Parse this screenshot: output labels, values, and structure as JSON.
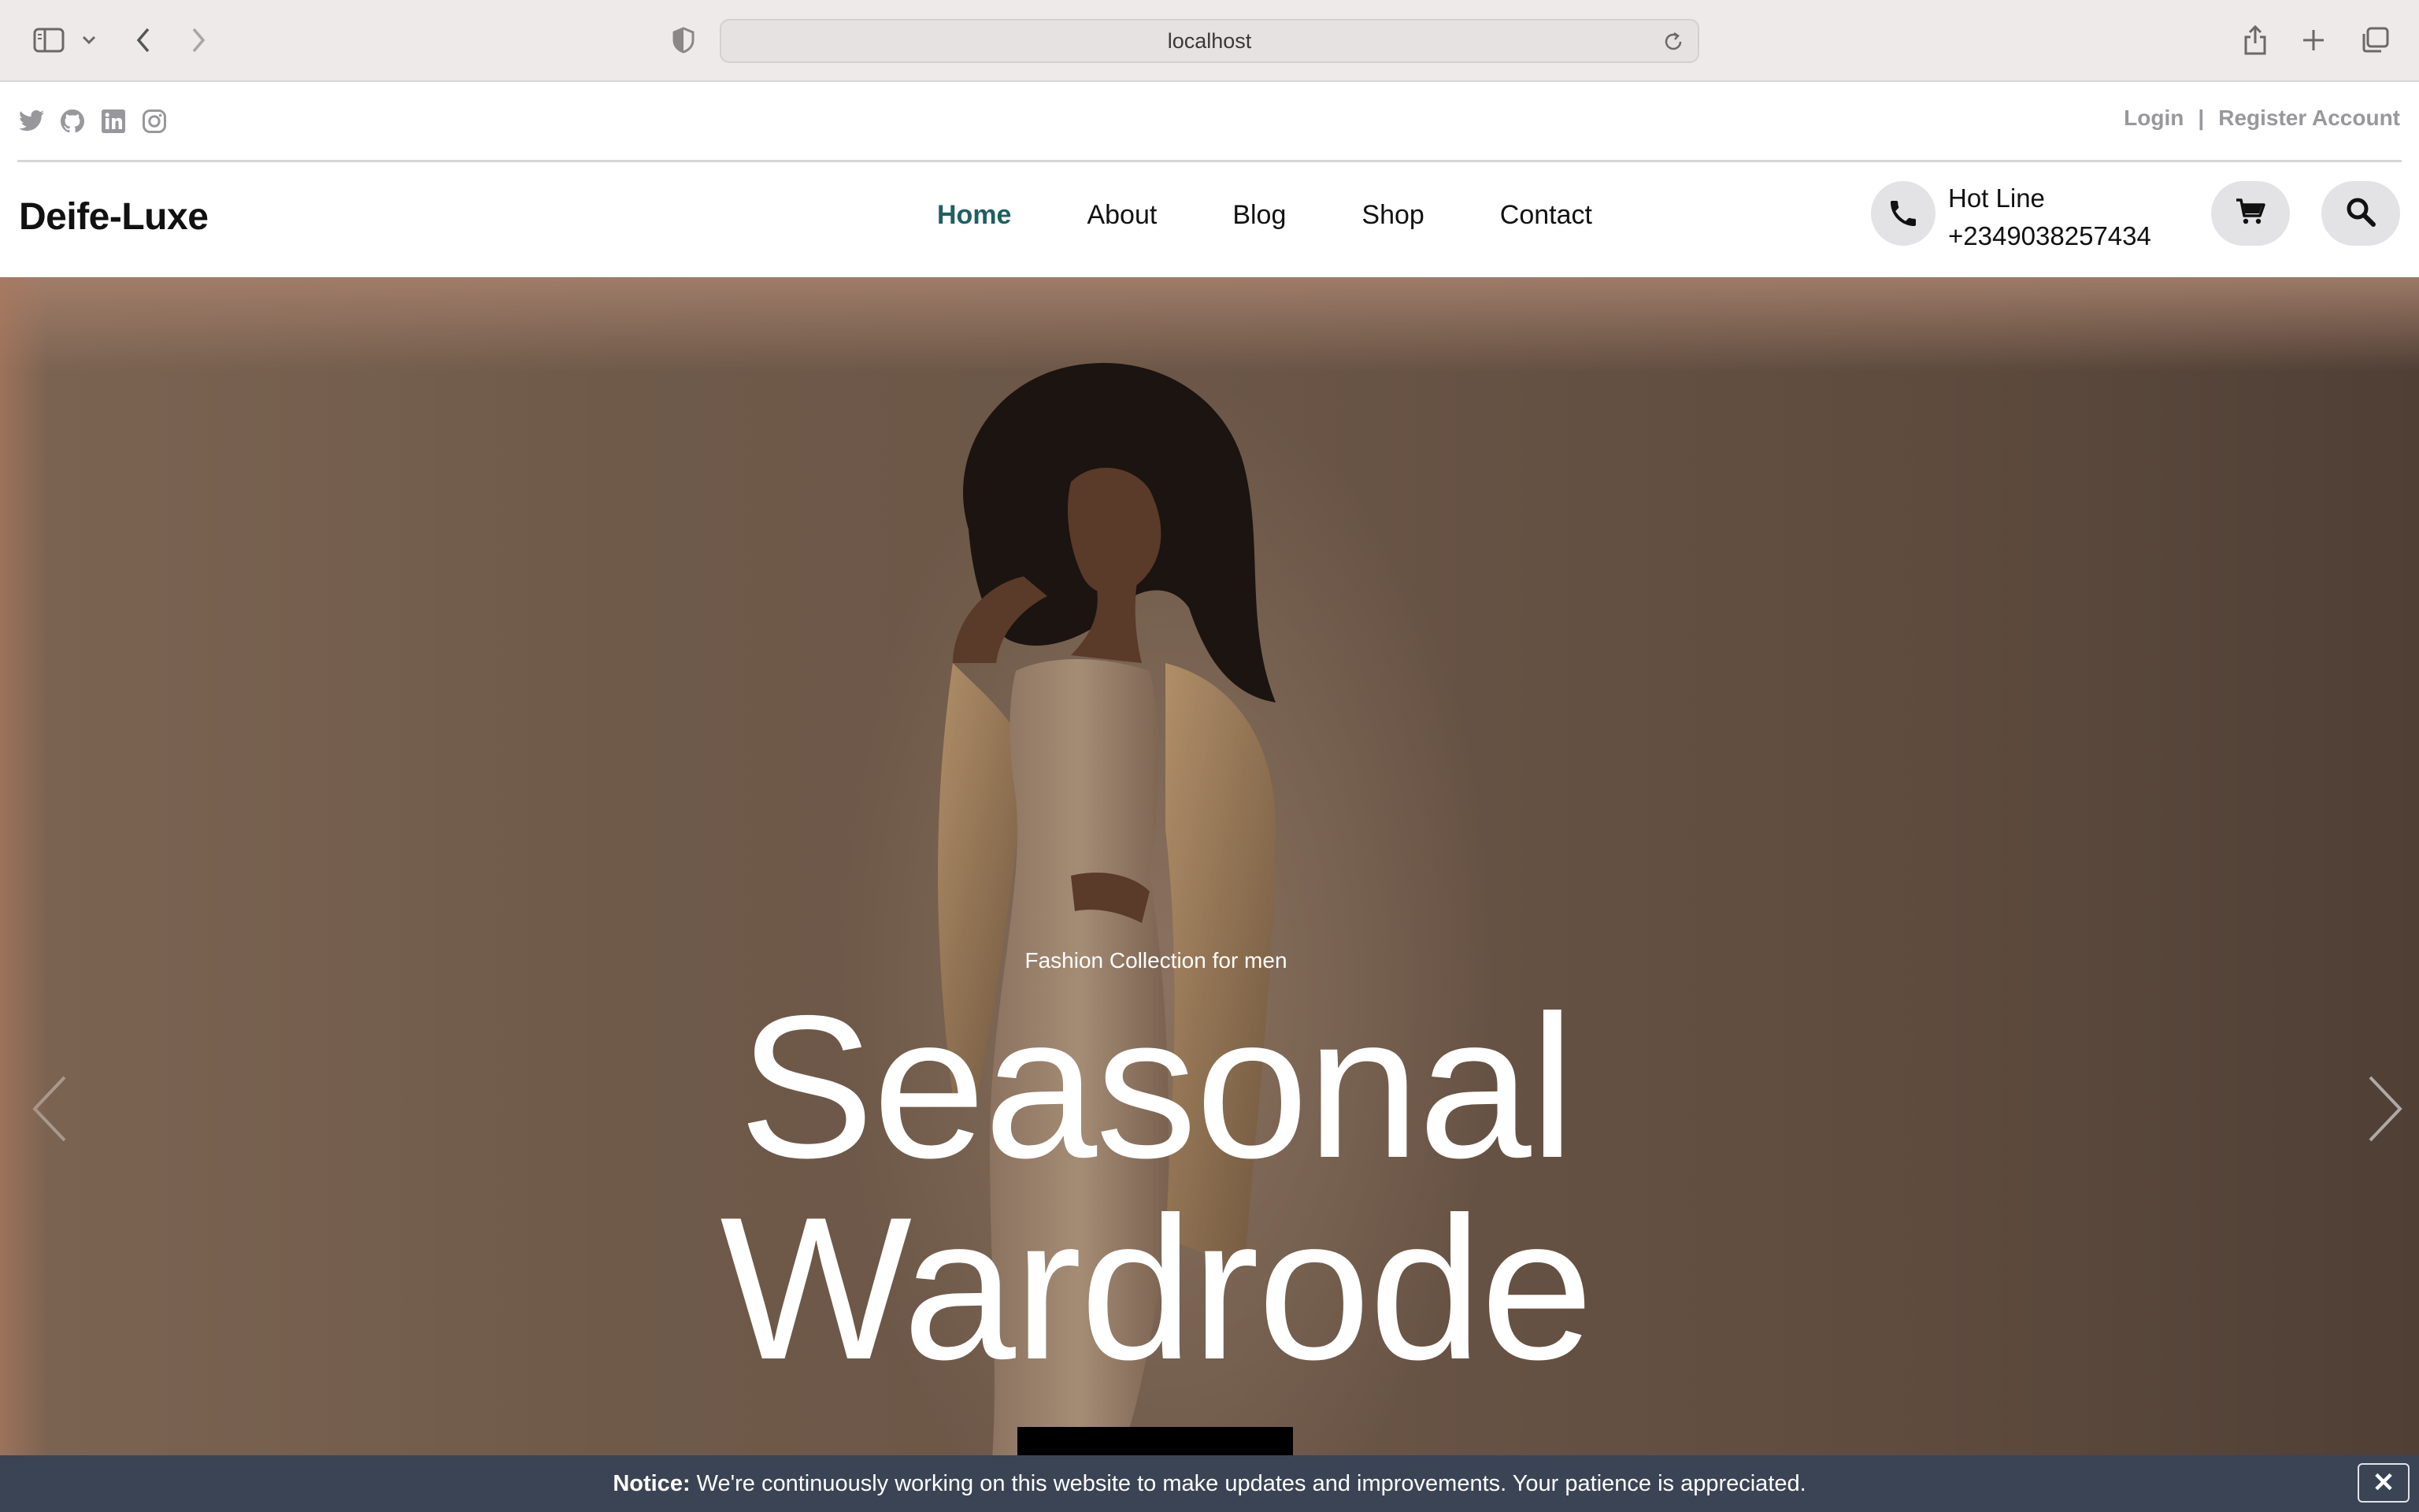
{
  "browser": {
    "url": "localhost"
  },
  "topbar": {
    "social_icons": [
      "twitter-icon",
      "github-icon",
      "linkedin-icon",
      "instagram-icon"
    ],
    "login_label": "Login",
    "separator": "|",
    "register_label": "Register Account"
  },
  "header": {
    "logo": "Deife-Luxe",
    "menu": [
      {
        "label": "Home",
        "active": true
      },
      {
        "label": "About",
        "active": false
      },
      {
        "label": "Blog",
        "active": false
      },
      {
        "label": "Shop",
        "active": false
      },
      {
        "label": "Contact",
        "active": false
      }
    ],
    "hotline_label": "Hot Line",
    "hotline_number": "+2349038257434"
  },
  "hero": {
    "eyebrow": "Fashion Collection for men",
    "headline_line1": "Seasonal",
    "headline_line2": "Wardrode"
  },
  "notice": {
    "label": "Notice:",
    "text": "We're continuously working on this website to make updates and improvements. Your patience is appreciated.",
    "close_symbol": "✕"
  },
  "colors": {
    "active_nav": "#1f5f63",
    "muted_text": "#98989c",
    "notice_bg": "#3b4454",
    "chip_bg": "#e3e3e6"
  }
}
